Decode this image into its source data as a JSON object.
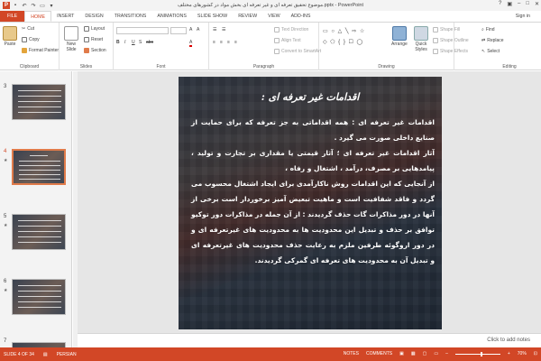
{
  "window": {
    "title": "موضوع تحقیق تعرفه ای و غیر تعرفه ای بخش مواد در کشورهای مختلف.pptx - PowerPoint",
    "signin": "Sign in",
    "help": "?"
  },
  "tabs": [
    {
      "label": "FILE"
    },
    {
      "label": "HOME"
    },
    {
      "label": "INSERT"
    },
    {
      "label": "DESIGN"
    },
    {
      "label": "TRANSITIONS"
    },
    {
      "label": "ANIMATIONS"
    },
    {
      "label": "SLIDE SHOW"
    },
    {
      "label": "REVIEW"
    },
    {
      "label": "VIEW"
    },
    {
      "label": "ADD-INS"
    }
  ],
  "ribbon": {
    "clipboard": {
      "label": "Clipboard",
      "paste": "Paste",
      "cut": "Cut",
      "copy": "Copy",
      "format_painter": "Format Painter"
    },
    "slides": {
      "label": "Slides",
      "new_slide": "New Slide",
      "layout": "Layout",
      "reset": "Reset",
      "section": "Section"
    },
    "font": {
      "label": "Font"
    },
    "paragraph": {
      "label": "Paragraph",
      "text_direction": "Text Direction",
      "align_text": "Align Text",
      "smartart": "Convert to SmartArt"
    },
    "drawing": {
      "label": "Drawing",
      "arrange": "Arrange",
      "quick_styles": "Quick Styles",
      "shape_fill": "Shape Fill",
      "shape_outline": "Shape Outline",
      "shape_effects": "Shape Effects"
    },
    "editing": {
      "label": "Editing",
      "find": "Find",
      "replace": "Replace",
      "select": "Select"
    }
  },
  "thumbnails": [
    {
      "number": "3",
      "star": "",
      "selected": false
    },
    {
      "number": "4",
      "star": "★",
      "selected": true
    },
    {
      "number": "5",
      "star": "★",
      "selected": false
    },
    {
      "number": "6",
      "star": "★",
      "selected": false
    },
    {
      "number": "7",
      "star": "",
      "selected": false
    }
  ],
  "slide": {
    "title": "اقدامات غیر تعرفه ای :",
    "paragraphs": [
      "اقدامات غیر تعرفه ای : همه اقداماتی به جز تعرفه که برای حمایت از صنایع داخلی صورت می گیرد .",
      "آثار اقدامات غیر تعرفه ای ؛ آثار قیمتی یا مقداری بر تجارت و تولید ، پیامدهایی بر مصرف، درآمد ، اشتغال و رفاه ،",
      "از آنجایی که این اقدامات روش ناکارآمدی برای ایجاد اشتغال محسوب می گردد و فاقد شفافیت است و ماهیت تبعیض آمیز برخوردار است برخی از آنها در دور مذاکرات گات حذف گردیدند : از آن جمله در مذاکرات دور توکیو توافق بر حذف و تبدیل این محدودیت ها به محدودیت های غیرتعرفه ای و در دور اروگوئه طرفین ملزم به رعایت حذف محدودیت های غیرتعرفه ای و تبدیل آن به محدودیت های تعرفه ای گمرکی گردیدند."
    ]
  },
  "notes": {
    "placeholder": "Click to add notes"
  },
  "status": {
    "slide": "SLIDE 4 OF 34",
    "language": "PERSIAN",
    "notes": "NOTES",
    "comments": "COMMENTS",
    "zoom": "70%"
  }
}
